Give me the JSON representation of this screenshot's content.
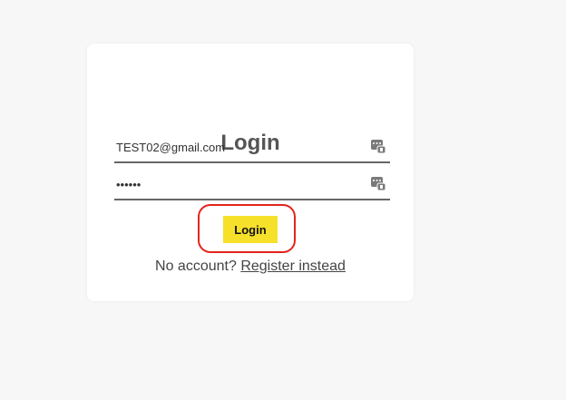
{
  "login_form": {
    "title": "Login",
    "email_value": "TEST02@gmail.com",
    "password_value": "secret",
    "submit_label": "Login",
    "register_prompt": "No account?",
    "register_link": "Register instead"
  },
  "icons": {
    "password_manager": "password-manager-icon"
  },
  "colors": {
    "page_background": "#f7f7f7",
    "card_background": "#ffffff",
    "title_text": "#555555",
    "button_background": "#f7e02a",
    "highlight_ring": "#e3241b"
  }
}
